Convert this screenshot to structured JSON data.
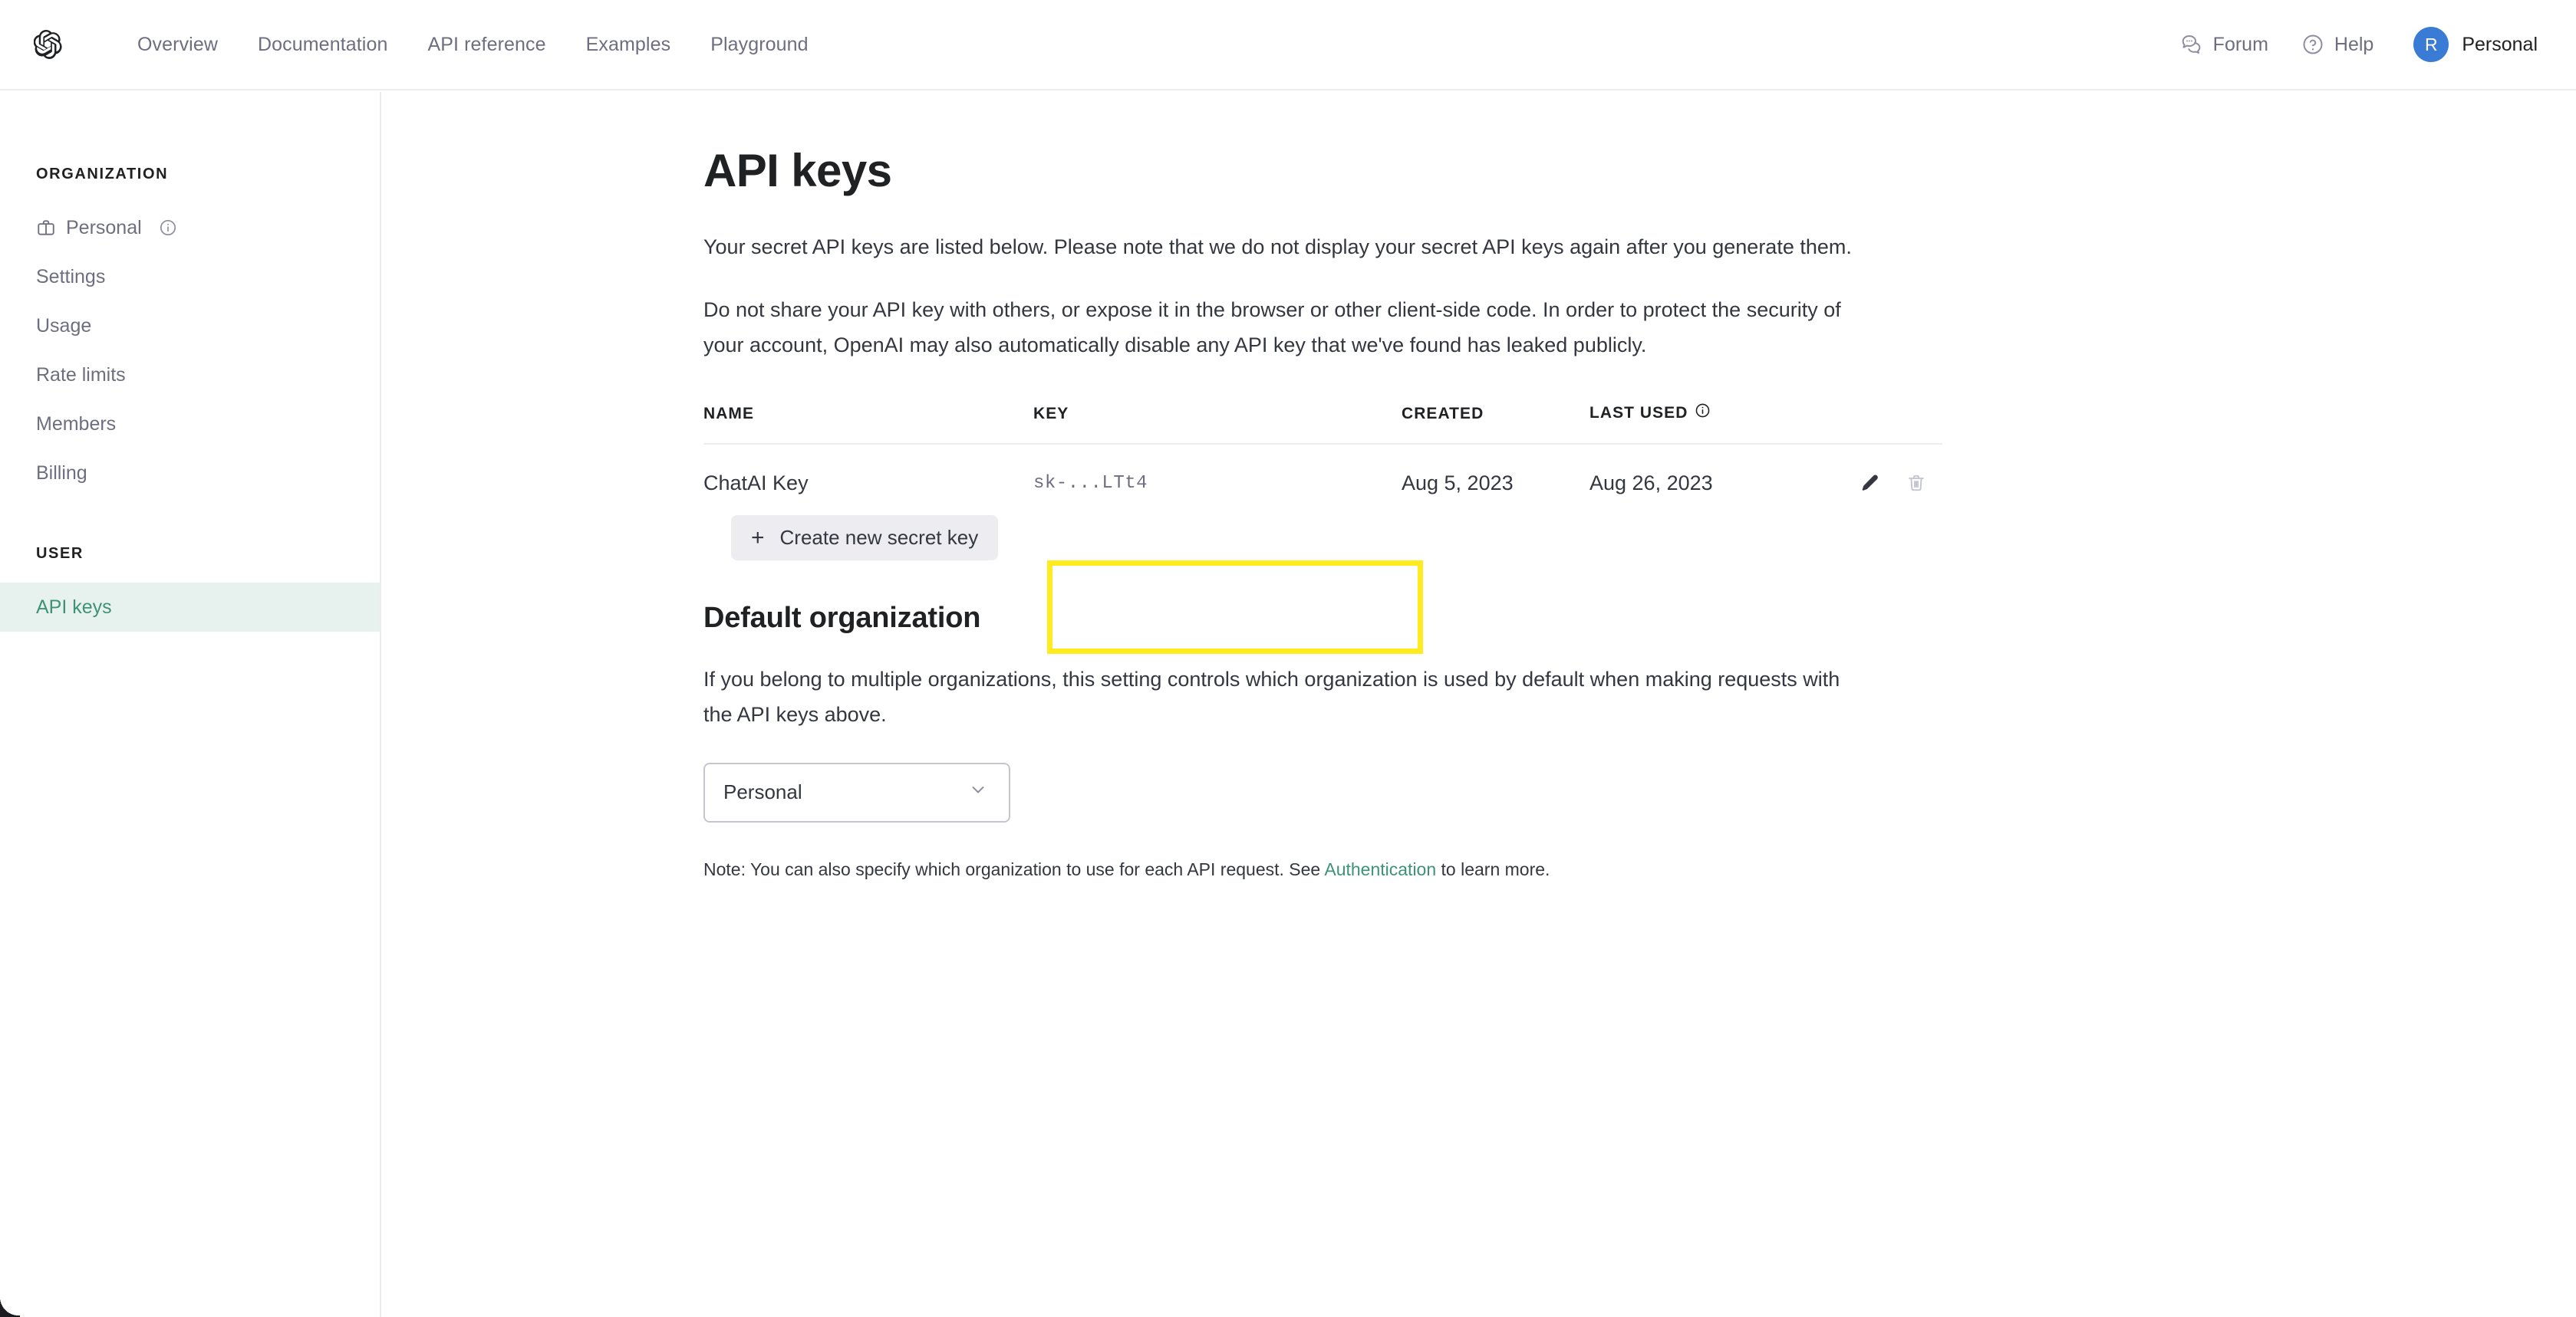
{
  "header": {
    "logo": "openai-logo",
    "nav": [
      {
        "label": "Overview"
      },
      {
        "label": "Documentation"
      },
      {
        "label": "API reference"
      },
      {
        "label": "Examples"
      },
      {
        "label": "Playground"
      }
    ],
    "forum_label": "Forum",
    "help_label": "Help",
    "avatar_initial": "R",
    "account_name": "Personal"
  },
  "sidebar": {
    "org_heading": "ORGANIZATION",
    "org_items": [
      {
        "label": "Personal"
      },
      {
        "label": "Settings"
      },
      {
        "label": "Usage"
      },
      {
        "label": "Rate limits"
      },
      {
        "label": "Members"
      },
      {
        "label": "Billing"
      }
    ],
    "user_heading": "USER",
    "user_items": [
      {
        "label": "API keys"
      }
    ],
    "active_item": "API keys",
    "active_bg": "#e7f2ef",
    "active_color": "#3e9276"
  },
  "main": {
    "title": "API keys",
    "paragraph_1": "Your secret API keys are listed below. Please note that we do not display your secret API keys again after you generate them.",
    "paragraph_2": "Do not share your API key with others, or expose it in the browser or other client-side code. In order to protect the security of your account, OpenAI may also automatically disable any API key that we've found has leaked publicly.",
    "table": {
      "columns": [
        "NAME",
        "KEY",
        "CREATED",
        "LAST USED"
      ],
      "rows": [
        {
          "name": "ChatAI Key",
          "key": "sk-...LTt4",
          "created": "Aug 5, 2023",
          "last_used": "Aug 26, 2023"
        }
      ]
    },
    "create_button_label": "Create new secret key",
    "create_button_plus": "+",
    "highlight_color": "#ffeb1f",
    "default_org": {
      "title": "Default organization",
      "description": "If you belong to multiple organizations, this setting controls which organization is used by default when making requests with the API keys above.",
      "selected": "Personal",
      "note_prefix": "Note: You can also specify which organization to use for each API request. See ",
      "note_link": "Authentication",
      "note_suffix": " to learn more."
    }
  }
}
